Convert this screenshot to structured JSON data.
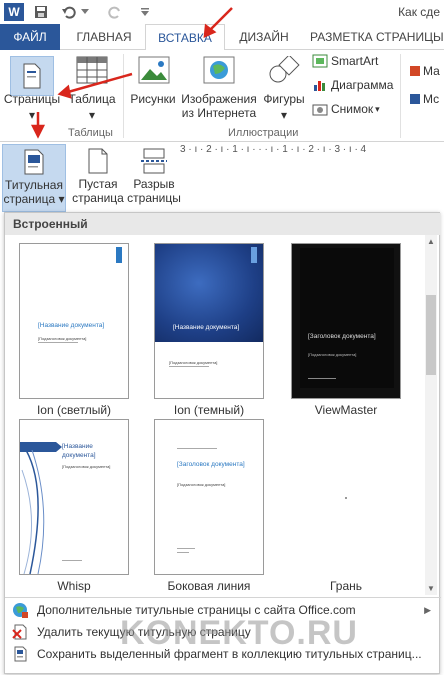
{
  "title_bar": {
    "doc_title": "Как сде"
  },
  "tabs": {
    "file": "ФАЙЛ",
    "home": "ГЛАВНАЯ",
    "insert": "ВСТАВКА",
    "design": "ДИЗАЙН",
    "layout": "РАЗМЕТКА СТРАНИЦЫ"
  },
  "ribbon": {
    "pages": "Страницы",
    "table": "Таблица",
    "pictures": "Рисунки",
    "online_pictures_1": "Изображения",
    "online_pictures_2": "из Интернета",
    "shapes": "Фигуры",
    "smartart": "SmartArt",
    "chart": "Диаграмма",
    "screenshot": "Снимок",
    "group_tables": "Таблицы",
    "group_illustrations": "Иллюстрации",
    "right_cut_1": "Ма",
    "right_cut_2": "Мс"
  },
  "pages_menu": {
    "cover_1": "Титульная",
    "cover_2": "страница",
    "blank_1": "Пустая",
    "blank_2": "страница",
    "break_1": "Разрыв",
    "break_2": "страницы"
  },
  "ruler": {
    "text": "3 · ı · 2 · ı · 1 · ı · · · ı · 1 · ı · 2 · ı · 3 · ı · 4"
  },
  "gallery": {
    "header": "Встроенный",
    "items": [
      {
        "caption": "Ion (светлый)",
        "doc_title": "[Название документа]",
        "subtitle": "[Подзаголовок документа]"
      },
      {
        "caption": "Ion (темный)",
        "doc_title": "[Название документа]",
        "subtitle": "[Подзаголовок документа]"
      },
      {
        "caption": "ViewMaster",
        "doc_title": "[Заголовок документа]",
        "subtitle": "[Подзаголовок документа]"
      },
      {
        "caption": "Whisp",
        "doc_title": "[Название документа]",
        "subtitle": "[Подзаголовок документа]"
      },
      {
        "caption": "Боковая линия",
        "doc_title": "[Заголовок документа]",
        "subtitle": "[Подзаголовок документа]"
      },
      {
        "caption": "Грань",
        "doc_title": "",
        "subtitle": ""
      }
    ]
  },
  "menu": {
    "more_covers": "Дополнительные титульные страницы с сайта Office.com",
    "remove_cover": "Удалить текущую титульную страницу",
    "save_selection": "Сохранить выделенный фрагмент в коллекцию титульных страниц..."
  },
  "watermark": "KONEKTO.RU",
  "colors": {
    "accent": "#2b579a",
    "arrow": "#d9261c",
    "selected": "#c5d9ef"
  }
}
